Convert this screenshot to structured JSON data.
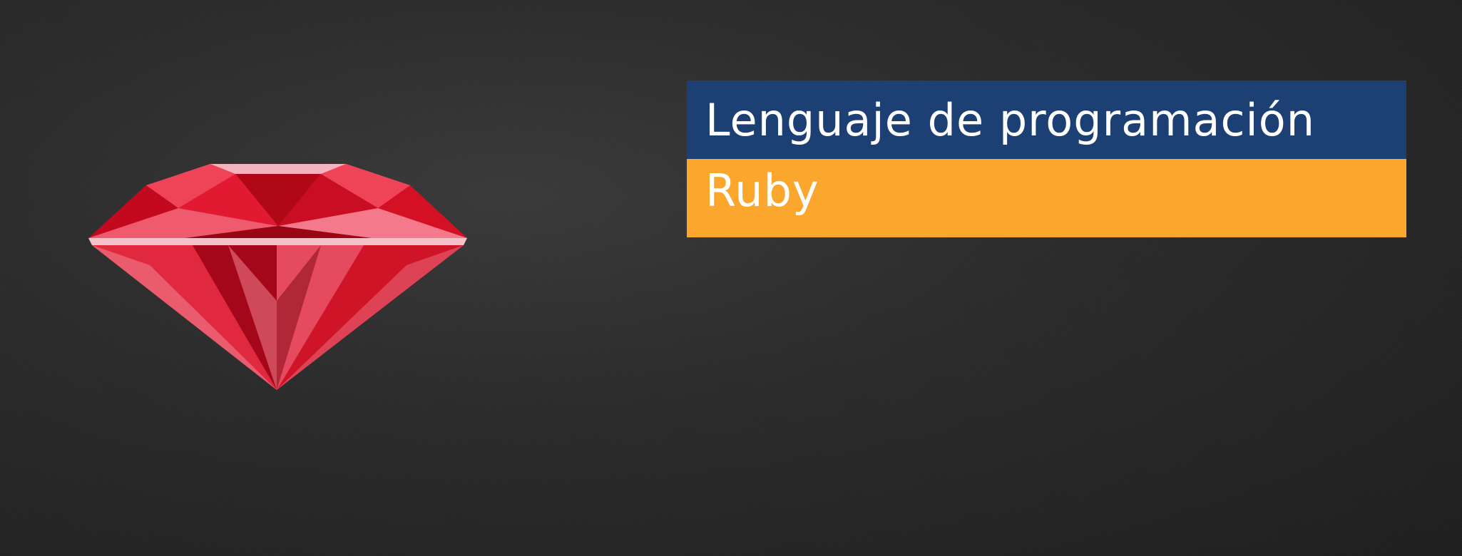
{
  "title": {
    "line1": "Lenguaje de programación",
    "line2": "Ruby"
  },
  "colors": {
    "background": "#2a2a2a",
    "title_bar_primary": "#1c3f74",
    "title_bar_accent": "#fba62c",
    "text": "#ffffff",
    "gem": "#d8121e"
  },
  "icons": {
    "gem": "ruby-gem-icon"
  }
}
